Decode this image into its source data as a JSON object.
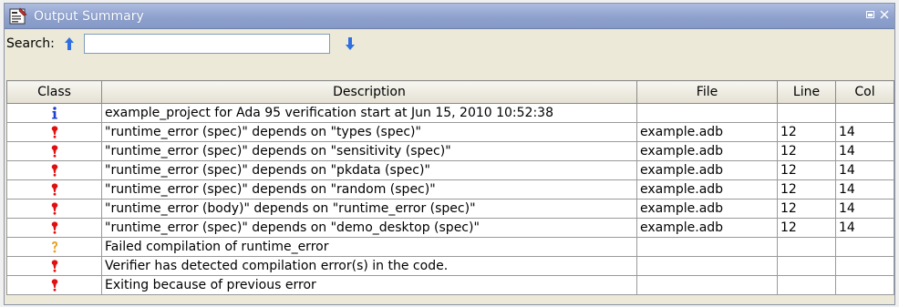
{
  "window": {
    "title": "Output Summary"
  },
  "search": {
    "label": "Search:",
    "value": "",
    "placeholder": ""
  },
  "table": {
    "columns": [
      "Class",
      "Description",
      "File",
      "Line",
      "Col"
    ],
    "rows": [
      {
        "class_icon": "info-icon",
        "description": "example_project for Ada 95 verification start at Jun 15, 2010 10:52:38",
        "file": "",
        "line": "",
        "col": ""
      },
      {
        "class_icon": "error-icon",
        "description": "\"runtime_error (spec)\" depends on \"types (spec)\"",
        "file": "example.adb",
        "line": "12",
        "col": "14"
      },
      {
        "class_icon": "error-icon",
        "description": "\"runtime_error (spec)\" depends on \"sensitivity (spec)\"",
        "file": "example.adb",
        "line": "12",
        "col": "14"
      },
      {
        "class_icon": "error-icon",
        "description": "\"runtime_error (spec)\" depends on \"pkdata (spec)\"",
        "file": "example.adb",
        "line": "12",
        "col": "14"
      },
      {
        "class_icon": "error-icon",
        "description": "\"runtime_error (spec)\" depends on \"random (spec)\"",
        "file": "example.adb",
        "line": "12",
        "col": "14"
      },
      {
        "class_icon": "error-icon",
        "description": "\"runtime_error (body)\" depends on \"runtime_error (spec)\"",
        "file": "example.adb",
        "line": "12",
        "col": "14"
      },
      {
        "class_icon": "error-icon",
        "description": "\"runtime_error (spec)\" depends on \"demo_desktop (spec)\"",
        "file": "example.adb",
        "line": "12",
        "col": "14"
      },
      {
        "class_icon": "warning-icon",
        "description": "Failed compilation of runtime_error",
        "file": "",
        "line": "",
        "col": ""
      },
      {
        "class_icon": "error-icon",
        "description": "Verifier has detected compilation error(s) in the code.",
        "file": "",
        "line": "",
        "col": ""
      },
      {
        "class_icon": "error-icon",
        "description": "Exiting because of previous error",
        "file": "",
        "line": "",
        "col": ""
      }
    ]
  },
  "colors": {
    "error": "#e01010",
    "warning": "#e8a020",
    "info": "#1a3fd0",
    "arrow": "#2f6fe0"
  }
}
